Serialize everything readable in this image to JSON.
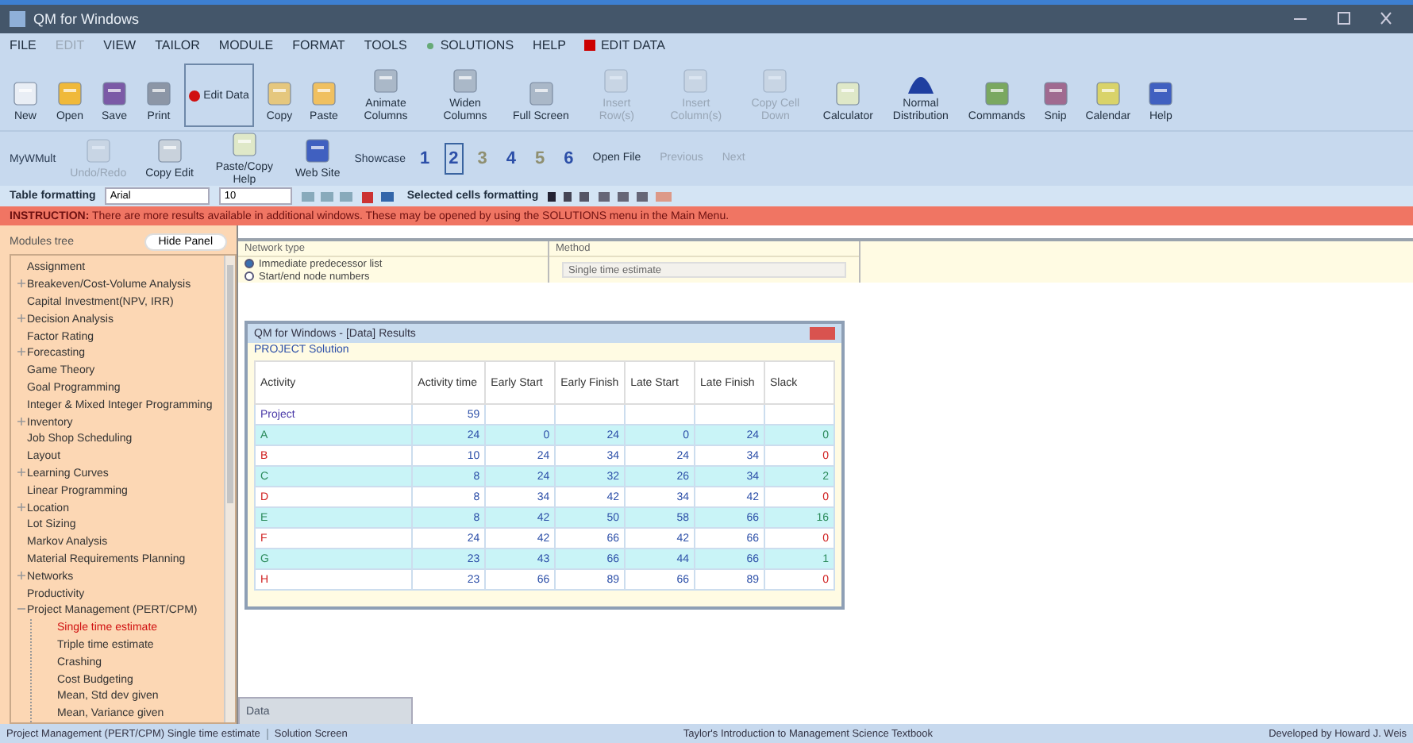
{
  "window": {
    "title": "QM for Windows"
  },
  "menu": [
    {
      "label": "FILE",
      "disabled": false,
      "kind": "plain"
    },
    {
      "label": "EDIT",
      "disabled": true,
      "kind": "plain"
    },
    {
      "label": "VIEW",
      "disabled": false,
      "kind": "plain"
    },
    {
      "label": "TAILOR",
      "disabled": false,
      "kind": "plain"
    },
    {
      "label": "MODULE",
      "disabled": false,
      "kind": "plain"
    },
    {
      "label": "FORMAT",
      "disabled": false,
      "kind": "plain"
    },
    {
      "label": "TOOLS",
      "disabled": false,
      "kind": "plain"
    },
    {
      "label": "SOLUTIONS",
      "disabled": false,
      "kind": "solutions"
    },
    {
      "label": "HELP",
      "disabled": false,
      "kind": "plain"
    },
    {
      "label": "EDIT DATA",
      "disabled": false,
      "kind": "editdata"
    }
  ],
  "toolbar": [
    {
      "label": "New",
      "disabled": false
    },
    {
      "label": "Open",
      "disabled": false
    },
    {
      "label": "Save",
      "disabled": false
    },
    {
      "label": "Print",
      "disabled": false
    },
    {
      "label": "Edit Data",
      "disabled": false,
      "kind": "edit"
    },
    {
      "label": "Copy",
      "disabled": false
    },
    {
      "label": "Paste",
      "disabled": false
    },
    {
      "label": "Animate Columns",
      "disabled": false
    },
    {
      "label": "Widen Columns",
      "disabled": false
    },
    {
      "label": "Full Screen",
      "disabled": false
    },
    {
      "label": "Insert Row(s)",
      "disabled": true
    },
    {
      "label": "Insert Column(s)",
      "disabled": true
    },
    {
      "label": "Copy Cell Down",
      "disabled": true
    },
    {
      "label": "Calculator",
      "disabled": false
    },
    {
      "label": "Normal Distribution",
      "disabled": false
    },
    {
      "label": "Commands",
      "disabled": false
    },
    {
      "label": "Snip",
      "disabled": false
    },
    {
      "label": "Calendar",
      "disabled": false
    },
    {
      "label": "Help",
      "disabled": false
    }
  ],
  "toolbar2": {
    "label": "MyWMult",
    "items": [
      {
        "label": "Undo/Redo",
        "disabled": true
      },
      {
        "label": "Copy Edit",
        "disabled": false
      },
      {
        "label": "Paste/Copy Help",
        "disabled": false
      },
      {
        "label": "Web Site",
        "disabled": false
      }
    ],
    "steps_label": "Showcase",
    "steps": [
      {
        "label": "1",
        "selected": false,
        "disabled": false
      },
      {
        "label": "2",
        "selected": true,
        "disabled": false
      },
      {
        "label": "3",
        "selected": false,
        "disabled": true
      },
      {
        "label": "4",
        "selected": false,
        "disabled": false
      },
      {
        "label": "5",
        "selected": false,
        "disabled": true
      },
      {
        "label": "6",
        "selected": false,
        "disabled": false
      }
    ],
    "nav": [
      {
        "label": "Open File",
        "disabled": false
      },
      {
        "label": "Previous",
        "disabled": true
      },
      {
        "label": "Next",
        "disabled": true
      }
    ]
  },
  "format_bar": {
    "label": "Table formatting",
    "font": "Arial",
    "size": "10",
    "cells_label": "Selected cells formatting"
  },
  "instruction": {
    "label": "INSTRUCTION:",
    "text": "There are more results available in additional windows. These may be opened by using the SOLUTIONS menu in the Main Menu."
  },
  "sidebar": {
    "title": "Modules tree",
    "hide_button": "Hide Panel",
    "items": [
      {
        "label": "Assignment",
        "selected": false
      },
      {
        "label": "Breakeven/Cost-Volume Analysis",
        "selected": false,
        "expanded": false
      },
      {
        "label": "Capital Investment(NPV, IRR)",
        "selected": false
      },
      {
        "label": "Decision Analysis",
        "selected": false,
        "expanded": false
      },
      {
        "label": "Factor Rating",
        "selected": false
      },
      {
        "label": "Forecasting",
        "selected": false,
        "expanded": false
      },
      {
        "label": "Game Theory",
        "selected": false
      },
      {
        "label": "Goal Programming",
        "selected": false
      },
      {
        "label": "Integer & Mixed Integer Programming",
        "selected": false
      },
      {
        "label": "Inventory",
        "selected": false,
        "expanded": false
      },
      {
        "label": "Job Shop Scheduling",
        "selected": false
      },
      {
        "label": "Layout",
        "selected": false
      },
      {
        "label": "Learning Curves",
        "selected": false,
        "expanded": false
      },
      {
        "label": "Linear Programming",
        "selected": false
      },
      {
        "label": "Location",
        "selected": false,
        "expanded": false
      },
      {
        "label": "Lot Sizing",
        "selected": false
      },
      {
        "label": "Markov Analysis",
        "selected": false
      },
      {
        "label": "Material Requirements Planning",
        "selected": false
      },
      {
        "label": "Networks",
        "selected": false,
        "expanded": false
      },
      {
        "label": "Productivity",
        "selected": false
      },
      {
        "label": "Project Management (PERT/CPM)",
        "selected": false,
        "expanded": true,
        "children": [
          {
            "label": "Single time estimate",
            "selected": true
          },
          {
            "label": "Triple time estimate",
            "selected": false
          },
          {
            "label": "Crashing",
            "selected": false
          },
          {
            "label": "Cost Budgeting",
            "selected": false
          },
          {
            "label": "Mean, Std dev given",
            "selected": false
          },
          {
            "label": "Mean, Variance given",
            "selected": false
          }
        ]
      }
    ]
  },
  "options": {
    "network_type": {
      "title": "Network type",
      "choices": [
        {
          "label": "Immediate predecessor list",
          "selected": true
        },
        {
          "label": "Start/end node numbers",
          "selected": false
        }
      ]
    },
    "method": {
      "title": "Method",
      "value": "Single time estimate"
    }
  },
  "results_window": {
    "title": "QM for Windows - [Data] Results",
    "subtitle": "PROJECT Solution",
    "columns": [
      "Activity",
      "Activity time",
      "Early Start",
      "Early Finish",
      "Late Start",
      "Late Finish",
      "Slack"
    ],
    "rows": [
      {
        "cells": [
          "Project",
          "59",
          "",
          "",
          "",
          "",
          ""
        ],
        "kind": "total"
      },
      {
        "cells": [
          "A",
          "24",
          "0",
          "24",
          "0",
          "24",
          "0"
        ],
        "kind": "activity",
        "critical": false
      },
      {
        "cells": [
          "B",
          "10",
          "24",
          "34",
          "24",
          "34",
          "0"
        ],
        "kind": "activity",
        "critical": true
      },
      {
        "cells": [
          "C",
          "8",
          "24",
          "32",
          "26",
          "34",
          "2"
        ],
        "kind": "activity",
        "critical": false
      },
      {
        "cells": [
          "D",
          "8",
          "34",
          "42",
          "34",
          "42",
          "0"
        ],
        "kind": "activity",
        "critical": true
      },
      {
        "cells": [
          "E",
          "8",
          "42",
          "50",
          "58",
          "66",
          "16"
        ],
        "kind": "activity",
        "critical": false
      },
      {
        "cells": [
          "F",
          "24",
          "42",
          "66",
          "42",
          "66",
          "0"
        ],
        "kind": "activity",
        "critical": true
      },
      {
        "cells": [
          "G",
          "23",
          "43",
          "66",
          "44",
          "66",
          "1"
        ],
        "kind": "activity",
        "critical": false
      },
      {
        "cells": [
          "H",
          "23",
          "66",
          "89",
          "66",
          "89",
          "0"
        ],
        "kind": "activity",
        "critical": true
      }
    ]
  },
  "minimized_window": {
    "title": "Data"
  },
  "status_bar": [
    "Project Management (PERT/CPM) Single time estimate",
    "Solution Screen",
    "Taylor's Introduction to Management Science Textbook",
    "Developed by Howard J. Weis"
  ]
}
